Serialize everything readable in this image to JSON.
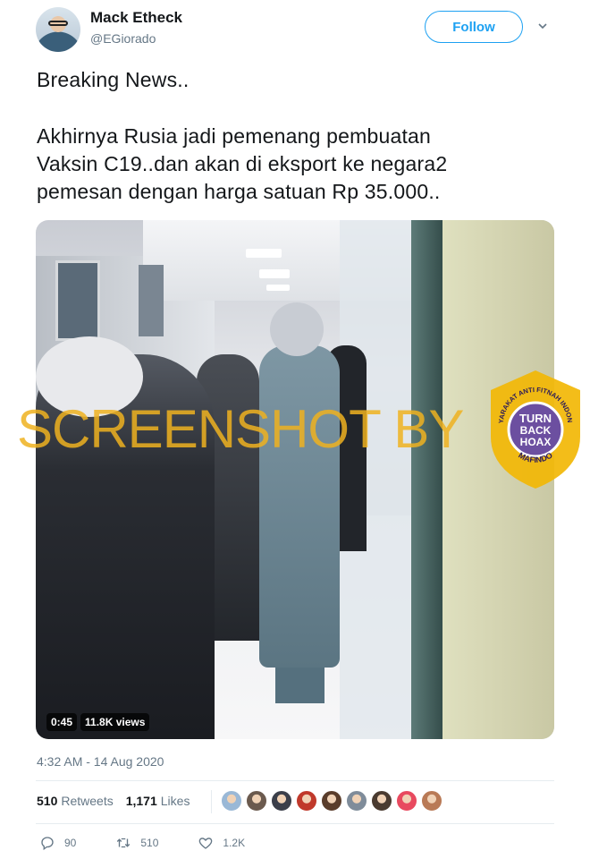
{
  "tweet": {
    "author_name": "Mack Etheck",
    "author_handle": "@EGiorado",
    "follow_label": "Follow",
    "text_line1": "Breaking News..",
    "text_line2": "Akhirnya Rusia jadi pemenang pembuatan",
    "text_line3": "Vaksin C19..dan akan di eksport ke negara2",
    "text_line4": "pemesan dengan harga satuan Rp 35.000..",
    "timestamp": "4:32 AM - 14 Aug 2020"
  },
  "media": {
    "duration": "0:45",
    "views": "11.8K views",
    "watermark": "SCREENSHOT BY",
    "badge_lines": [
      "TURN",
      "BACK",
      "HOAX"
    ],
    "badge_top_text": "MASYARAKAT ANTI FITNAH INDONESIA",
    "badge_bottom_text": "MAFINDO"
  },
  "stats": {
    "retweets_count": "510",
    "retweets_label": "Retweets",
    "likes_count": "1,171",
    "likes_label": "Likes",
    "liker_colors": [
      "#9ab8d6",
      "#6b5a4e",
      "#3b3f4a",
      "#c0392b",
      "#5a3d2b",
      "#7f8c9a",
      "#4a3b30",
      "#e84a5f",
      "#b97a56"
    ]
  },
  "actions": {
    "replies": "90",
    "retweets": "510",
    "likes": "1.2K"
  },
  "colors": {
    "accent": "#1da1f2",
    "muted": "#657786",
    "watermark": "#eeb220",
    "badge": "#f2b705"
  }
}
